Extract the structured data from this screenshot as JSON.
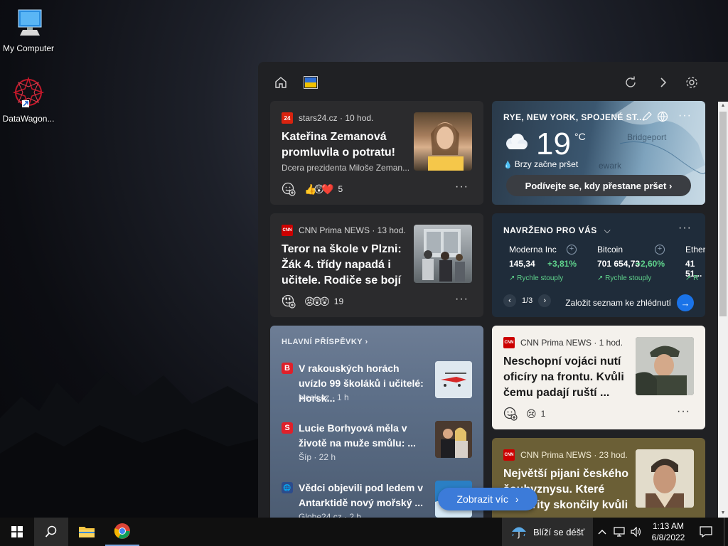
{
  "desktop": {
    "icons": [
      {
        "label": "My Computer",
        "icon": "computer-icon"
      },
      {
        "label": "DataWagon...",
        "icon": "datawagon-icon"
      }
    ]
  },
  "widgets": {
    "topbar": {
      "icons": [
        "home-icon",
        "flag-icon",
        "refresh-icon",
        "forward-icon",
        "settings-icon"
      ]
    },
    "cards": {
      "stars": {
        "source": "stars24.cz · 10 hod.",
        "logo_text": "24",
        "headline": "Kateřina Zemanová promluvila o potratu!",
        "subtitle": "Dcera prezidenta Miloše Zeman...",
        "reactions": "👍😲❤️",
        "reaction_count": "5",
        "more": "···"
      },
      "weather": {
        "location": "RYE, NEW YORK, SPOJENÉ ST...",
        "temperature": "19",
        "unit": "°C",
        "condition": "Brzy začne pršet",
        "cta": "Podívejte se, kdy přestane pršet",
        "more": "···"
      },
      "cnn1": {
        "source": "CNN Prima NEWS · 13 hod.",
        "logo_text": "CNN",
        "headline": "Teror na škole v Plzni: Žák 4. třídy napadá i učitele. Rodiče se bojí ...",
        "reactions": "😡😲😲",
        "reaction_count": "19",
        "more": "···"
      },
      "stocks": {
        "title": "NAVRŽENO PRO VÁS",
        "more": "···",
        "items": [
          {
            "name": "Moderna Inc",
            "price": "145,34",
            "change": "+3,81%",
            "trend": "Rychle stouply"
          },
          {
            "name": "Bitcoin",
            "price": "701 654,73",
            "change": "+2,60%",
            "trend": "Rychle stouply"
          },
          {
            "name": "Ether",
            "price": "41 51...",
            "change": "",
            "trend": "R"
          }
        ],
        "pager": "1/3",
        "watchlist": "Založit seznam ke zhlédnutí"
      },
      "top_stories": {
        "header": "HLAVNÍ PŘÍSPĚVKY",
        "items": [
          {
            "logo": "B",
            "color": "#e0202a",
            "headline": "V rakouských horách uvízlo 99 školáků i učitelé: Horsk...",
            "meta": "blesk.cz · 1 h"
          },
          {
            "logo": "S",
            "color": "#e0202a",
            "headline": "Lucie Borhyová měla v životě na muže smůlu: ...",
            "meta": "Šíp · 22 h"
          },
          {
            "logo": "🌐",
            "color": "#2c4c8c",
            "headline": "Vědci objevili pod ledem v Antarktidě nový mořský ...",
            "meta": "Globe24.cz · 2 h"
          }
        ]
      },
      "cnn2": {
        "source": "CNN Prima NEWS · 1 hod.",
        "logo_text": "CNN",
        "headline": "Neschopní vojáci nutí oficíry na frontu. Kvůli čemu padají ruští ...",
        "reactions": "😢",
        "reaction_count": "1",
        "more": "···"
      },
      "cnn3": {
        "source": "CNN Prima NEWS · 23 hod.",
        "logo_text": "CNN",
        "headline": "Největší pijani českého šoubyznysu. Které celebrity skončily kvůli ..."
      }
    },
    "more_button": "Zobrazit víc"
  },
  "taskbar": {
    "weather_text": "Blíží se déšť",
    "time": "1:13 AM",
    "date": "6/8/2022"
  },
  "colors": {
    "accent": "#1a73e8",
    "positive": "#5fd38c",
    "panel": "#202124"
  }
}
